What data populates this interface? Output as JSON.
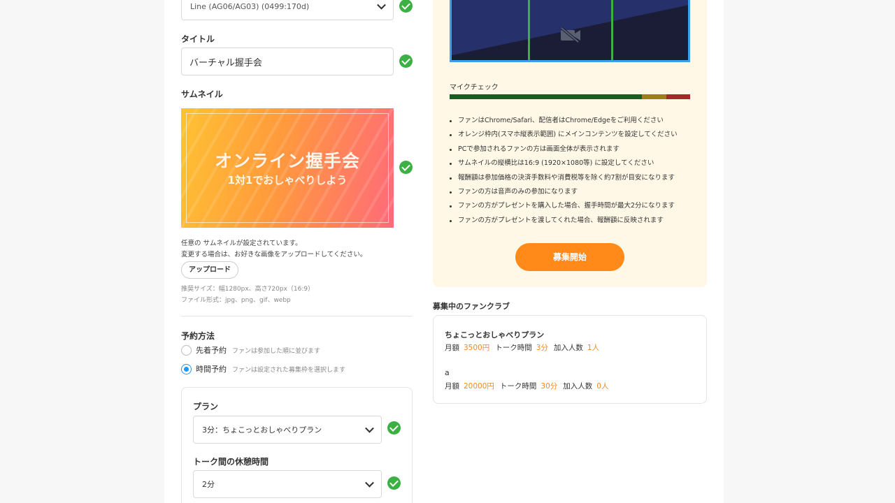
{
  "line_select": {
    "value": "Line (AG06/AG03) (0499:170d)"
  },
  "title_field": {
    "label": "タイトル",
    "value": "バーチャル握手会"
  },
  "thumbnail": {
    "label": "サムネイル",
    "image_title": "オンライン握手会",
    "image_subtitle": "1対1でおしゃべりしよう",
    "status_line1": "任意の サムネイルが設定されています。",
    "status_line2": "変更する場合は、お好きな画像をアップロードしてください。",
    "upload_label": "アップロード",
    "size_hint": "推奨サイズ：幅1280px、高さ720px（16:9）",
    "format_hint": "ファイル形式：jpg、png、gif、webp"
  },
  "reservation": {
    "label": "予約方法",
    "options": [
      {
        "label": "先着予約",
        "hint": "ファンは参加した順に並びます",
        "selected": false
      },
      {
        "label": "時間予約",
        "hint": "ファンは設定された募集枠を選択します",
        "selected": true
      }
    ]
  },
  "plan_card": {
    "plan_label": "プラン",
    "plan_value": "3分：ちょこっとおしゃべりプラン",
    "break_label": "トーク間の休憩時間",
    "break_value": "2分"
  },
  "preview": {
    "mic_label": "マイクチェック",
    "mic_level": 0.8,
    "notes": [
      "ファンはChrome/Safari、配信者はChrome/Edgeをご利用ください",
      "オレンジ枠内(スマホ縦表示範囲) にメインコンテンツを設定してください",
      "PCで参加されるファンの方は画面全体が表示されます",
      "サムネイルの縦横比は16:9 (1920×1080等) に設定してください",
      "報酬額は参加価格の決済手数料や消費税等を除く約7割が目安になります",
      "ファンの方は音声のみの参加になります",
      "ファンの方がプレゼントを購入した場合、握手時間が最大2分になります",
      "ファンの方がプレゼントを渡してくれた場合、報酬額に反映されます"
    ],
    "start_button": "募集開始"
  },
  "fanclubs": {
    "heading": "募集中のファンクラブ",
    "stat_labels": {
      "monthly": "月額",
      "talk_time": "トーク時間",
      "members": "加入人数"
    },
    "items": [
      {
        "name": "ちょこっとおしゃべりプラン",
        "monthly": "3500円",
        "talk_time": "3分",
        "members": "1人"
      },
      {
        "name": "a",
        "monthly": "20000円",
        "talk_time": "30分",
        "members": "0人"
      }
    ]
  },
  "colors": {
    "accent": "#ff8a1a",
    "check_green": "#3cb043",
    "radio_blue": "#2196f3",
    "panel_bg": "#fff8e7"
  },
  "icons": [
    "check-icon",
    "chevron-down-icon",
    "camera-off-icon"
  ]
}
